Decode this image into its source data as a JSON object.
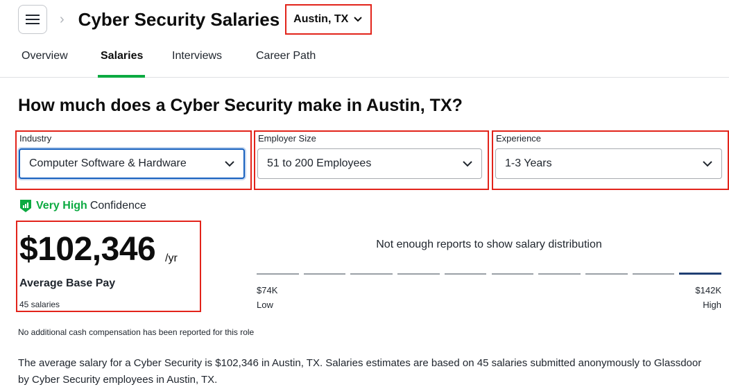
{
  "header": {
    "title": "Cyber Security Salaries",
    "location": "Austin, TX"
  },
  "tabs": [
    {
      "label": "Overview",
      "active": false
    },
    {
      "label": "Salaries",
      "active": true
    },
    {
      "label": "Interviews",
      "active": false
    },
    {
      "label": "Career Path",
      "active": false
    }
  ],
  "headline": "How much does a Cyber Security make in Austin, TX?",
  "filters": {
    "industry": {
      "label": "Industry",
      "value": "Computer Software & Hardware"
    },
    "employer_size": {
      "label": "Employer Size",
      "value": "51 to 200 Employees"
    },
    "experience": {
      "label": "Experience",
      "value": "1-3 Years"
    }
  },
  "confidence": {
    "level": "Very High",
    "word": "Confidence"
  },
  "pay": {
    "amount": "$102,346",
    "unit": "/yr",
    "label": "Average Base Pay",
    "count": "45 salaries"
  },
  "distribution": {
    "message": "Not enough reports to show salary distribution",
    "segment_count": 10,
    "highlighted_segment": 10,
    "min": "$74K",
    "min_label": "Low",
    "max": "$142K",
    "max_label": "High"
  },
  "no_cash_note": "No additional cash compensation has been reported for this role",
  "summary": "The average salary for a Cyber Security is $102,346 in Austin, TX. Salaries estimates are based on 45 salaries submitted anonymously to Glassdoor by Cyber Security employees in Austin, TX.",
  "colors": {
    "accent_green": "#0caa41",
    "annotation_red": "#e2231a",
    "focus_blue": "#1861bf",
    "highlight_bar": "#1f3f73"
  }
}
